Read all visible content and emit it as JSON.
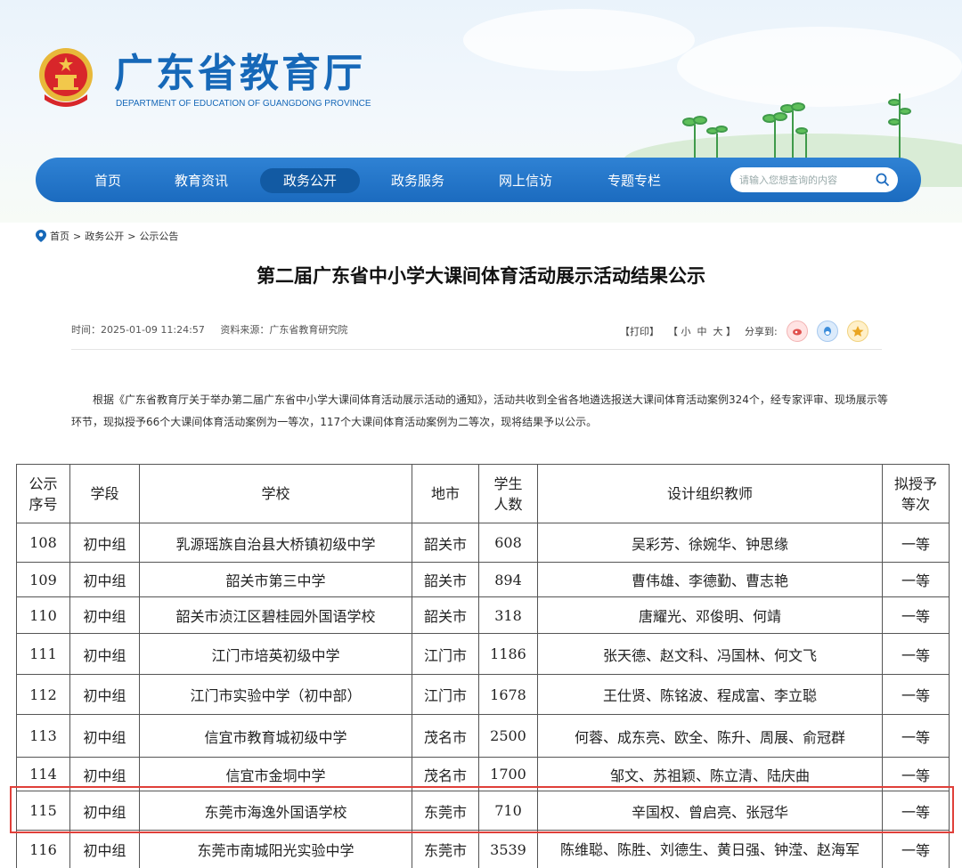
{
  "header": {
    "site_title": "广东省教育厅",
    "site_subtitle": "DEPARTMENT OF EDUCATION OF GUANGDONG PROVINCE",
    "emblem_icon": "national-emblem-icon",
    "brand_color": "#1668b8"
  },
  "nav": {
    "items": [
      {
        "label": "首页"
      },
      {
        "label": "教育资讯"
      },
      {
        "label": "政务公开",
        "active": true
      },
      {
        "label": "政务服务"
      },
      {
        "label": "网上信访"
      },
      {
        "label": "专题专栏"
      }
    ],
    "search_placeholder": "请输入您想查询的内容",
    "nav_color": "#1b6bbf"
  },
  "breadcrumb": {
    "home": "首页",
    "sep1": ">",
    "section": "政务公开",
    "sep2": ">",
    "current": "公示公告"
  },
  "article": {
    "title": "第二届广东省中小学大课间体育活动展示活动结果公示",
    "time": "时间：2025-01-09 11:24:57",
    "source": "资料来源：广东省教育研究院",
    "print": "【打印】",
    "font_size_label": "【 小  中  大 】",
    "share_label": "分享到:",
    "share_icons": [
      "weibo-icon",
      "qq-icon",
      "qzone-icon"
    ],
    "intro": "根据《广东省教育厅关于举办第二届广东省中小学大课间体育活动展示活动的通知》，活动共收到全省各地遴选报送大课间体育活动案例324个，经专家评审、现场展示等环节，现拟授予66个大课间体育活动案例为一等次，117个大课间体育活动案例为二等次，现将结果予以公示。"
  },
  "table": {
    "headers": {
      "no": "公示\n序号",
      "stage": "学段",
      "school": "学校",
      "city": "地市",
      "students": "学生\n人数",
      "teachers": "设计组织教师",
      "rank": "拟授予\n等次"
    },
    "rows": [
      {
        "no": "108",
        "stage": "初中组",
        "school": "乳源瑶族自治县大桥镇初级中学",
        "city": "韶关市",
        "students": "608",
        "teachers": "吴彩芳、徐婉华、钟思缘",
        "rank": "一等"
      },
      {
        "no": "109",
        "stage": "初中组",
        "school": "韶关市第三中学",
        "city": "韶关市",
        "students": "894",
        "teachers": "曹伟雄、李德勤、曹志艳",
        "rank": "一等"
      },
      {
        "no": "110",
        "stage": "初中组",
        "school": "韶关市浈江区碧桂园外国语学校",
        "city": "韶关市",
        "students": "318",
        "teachers": "唐耀光、邓俊明、何靖",
        "rank": "一等"
      },
      {
        "no": "111",
        "stage": "初中组",
        "school": "江门市培英初级中学",
        "city": "江门市",
        "students": "1186",
        "teachers": "张天德、赵文科、冯国林、何文飞",
        "rank": "一等"
      },
      {
        "no": "112",
        "stage": "初中组",
        "school": "江门市实验中学（初中部）",
        "city": "江门市",
        "students": "1678",
        "teachers": "王仕贤、陈铭波、程成富、李立聪",
        "rank": "一等"
      },
      {
        "no": "113",
        "stage": "初中组",
        "school": "信宜市教育城初级中学",
        "city": "茂名市",
        "students": "2500",
        "teachers": "何蓉、成东亮、欧全、陈升、周展、俞冠群",
        "rank": "一等"
      },
      {
        "no": "114",
        "stage": "初中组",
        "school": "信宜市金垌中学",
        "city": "茂名市",
        "students": "1700",
        "teachers": "邹文、苏祖颖、陈立清、陆庆曲",
        "rank": "一等"
      },
      {
        "no": "115",
        "stage": "初中组",
        "school": "东莞市海逸外国语学校",
        "city": "东莞市",
        "students": "710",
        "teachers": "辛国权、曾启亮、张冠华",
        "rank": "一等",
        "highlighted": true
      },
      {
        "no": "116",
        "stage": "初中组",
        "school": "东莞市南城阳光实验中学",
        "city": "东莞市",
        "students": "3539",
        "teachers": "陈维聪、陈胜、刘德生、黄日强、钟滢、赵海军",
        "rank": "一等"
      }
    ],
    "highlight_color": "#e0403a"
  }
}
